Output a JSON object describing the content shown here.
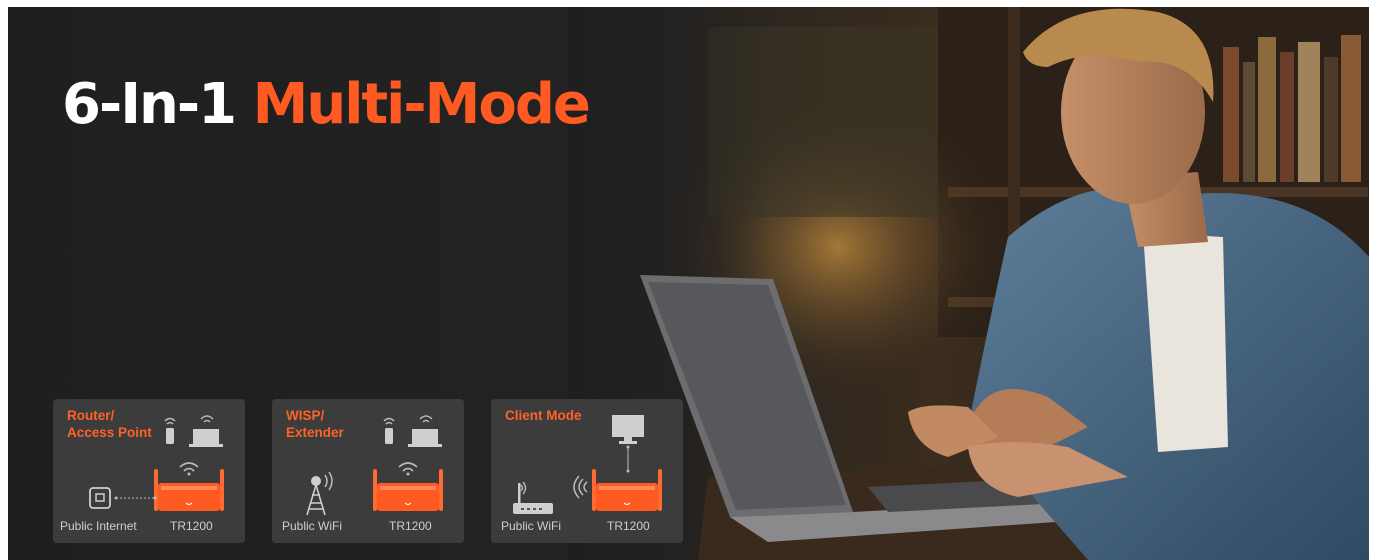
{
  "headline": {
    "white": "6-In-1 ",
    "orange": "Multi-Mode"
  },
  "colors": {
    "accent": "#ff5a22",
    "card_bg": "#3c3c3c",
    "background": "#1f1f1f"
  },
  "modes": [
    {
      "title": "Router/\nAccess Point",
      "source_label": "Public Internet",
      "device_label": "TR1200",
      "source_icon": "ethernet-port-icon"
    },
    {
      "title": "WISP/\nExtender",
      "source_label": "Public WiFi",
      "device_label": "TR1200",
      "source_icon": "wifi-tower-icon"
    },
    {
      "title": "Client Mode",
      "source_label": "Public WiFi",
      "device_label": "TR1200",
      "source_icon": "router-icon"
    }
  ]
}
